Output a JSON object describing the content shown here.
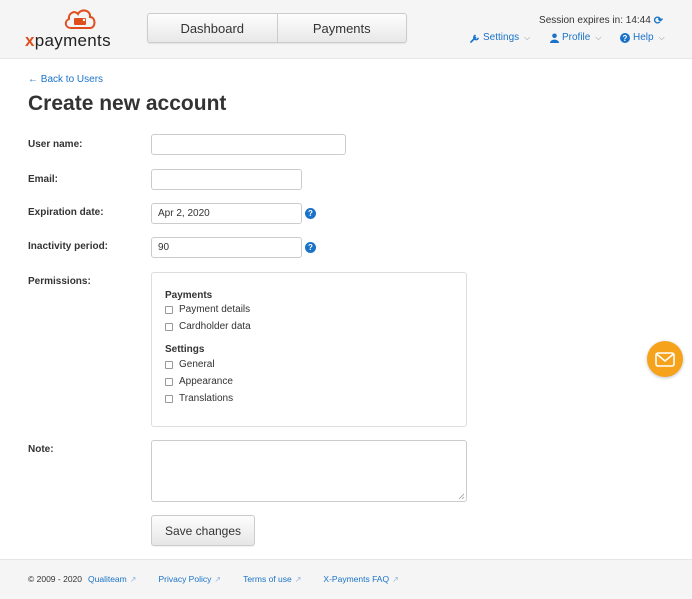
{
  "header": {
    "logo_text": "xpayments",
    "tabs": [
      {
        "label": "Dashboard"
      },
      {
        "label": "Payments"
      }
    ],
    "session_text": "Session expires in: 14:44",
    "menus": {
      "settings": "Settings",
      "profile": "Profile",
      "help": "Help"
    }
  },
  "page": {
    "back_link": "← Back to Users",
    "title": "Create new account"
  },
  "form": {
    "username": {
      "label": "User name:",
      "value": ""
    },
    "email": {
      "label": "Email:",
      "value": ""
    },
    "expiration": {
      "label": "Expiration date:",
      "value": "Apr 2, 2020"
    },
    "inactivity": {
      "label": "Inactivity period:",
      "value": "90"
    },
    "permissions": {
      "label": "Permissions:",
      "groups": [
        {
          "title": "Payments",
          "items": [
            "Payment details",
            "Cardholder data"
          ]
        },
        {
          "title": "Settings",
          "items": [
            "General",
            "Appearance",
            "Translations"
          ]
        }
      ]
    },
    "note": {
      "label": "Note:",
      "value": ""
    },
    "save_label": "Save changes"
  },
  "footer": {
    "copyright": "© 2009 - 2020",
    "links": [
      "Qualiteam",
      "Privacy Policy",
      "Terms of use",
      "X-Payments FAQ"
    ]
  },
  "colors": {
    "accent": "#1a73c8",
    "brand_orange": "#e04e1b",
    "fab": "#f6a21a"
  }
}
